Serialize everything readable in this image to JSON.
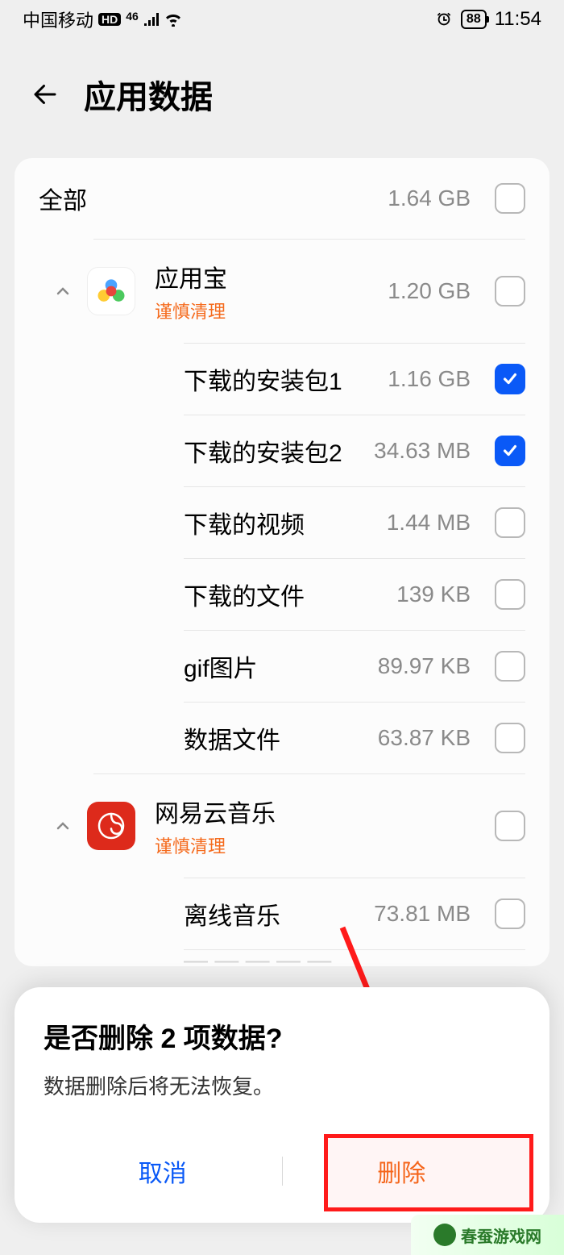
{
  "status": {
    "carrier": "中国移动",
    "hd": "HD",
    "net": "46",
    "battery": "88",
    "time": "11:54"
  },
  "header": {
    "title": "应用数据"
  },
  "all": {
    "label": "全部",
    "size": "1.64 GB"
  },
  "apps": [
    {
      "name": "应用宝",
      "warn": "谨慎清理",
      "size": "1.20 GB",
      "items": [
        {
          "label": "下载的安装包1",
          "size": "1.16 GB",
          "checked": true
        },
        {
          "label": "下载的安装包2",
          "size": "34.63 MB",
          "checked": true
        },
        {
          "label": "下载的视频",
          "size": "1.44 MB",
          "checked": false
        },
        {
          "label": "下载的文件",
          "size": "139 KB",
          "checked": false
        },
        {
          "label": "gif图片",
          "size": "89.97 KB",
          "checked": false
        },
        {
          "label": "数据文件",
          "size": "63.87 KB",
          "checked": false
        }
      ]
    },
    {
      "name": "网易云音乐",
      "warn": "谨慎清理",
      "size": "",
      "items": [
        {
          "label": "离线音乐",
          "size": "73.81 MB",
          "checked": false
        }
      ]
    }
  ],
  "dialog": {
    "title": "是否删除 2 项数据?",
    "subtitle": "数据删除后将无法恢复。",
    "cancel": "取消",
    "delete": "删除"
  },
  "watermark": {
    "text": "春蚕游戏网"
  }
}
